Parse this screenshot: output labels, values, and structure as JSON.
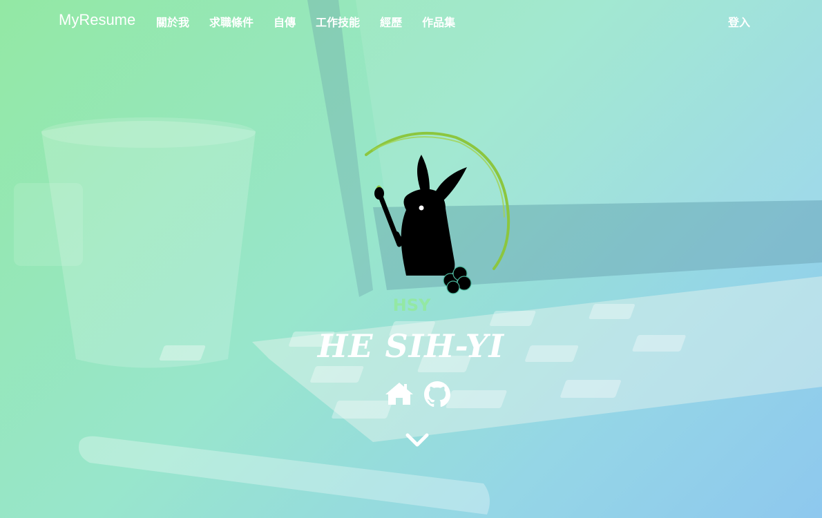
{
  "navbar": {
    "brand": "MyResume",
    "items": [
      {
        "label": "關於我"
      },
      {
        "label": "求職條件"
      },
      {
        "label": "自傳"
      },
      {
        "label": "工作技能"
      },
      {
        "label": "經歷"
      },
      {
        "label": "作品集"
      }
    ],
    "login_label": "登入"
  },
  "hero": {
    "logo_text": "HSY",
    "name": "HE SIH-YI",
    "social_icons": [
      "home-icon",
      "github-icon"
    ],
    "scroll_icon": "chevron-down-icon"
  },
  "colors": {
    "gradient_start": "#93e8a4",
    "gradient_end": "#8ec8ee",
    "logo_ring": "#8cc63f",
    "text": "#ffffff"
  }
}
